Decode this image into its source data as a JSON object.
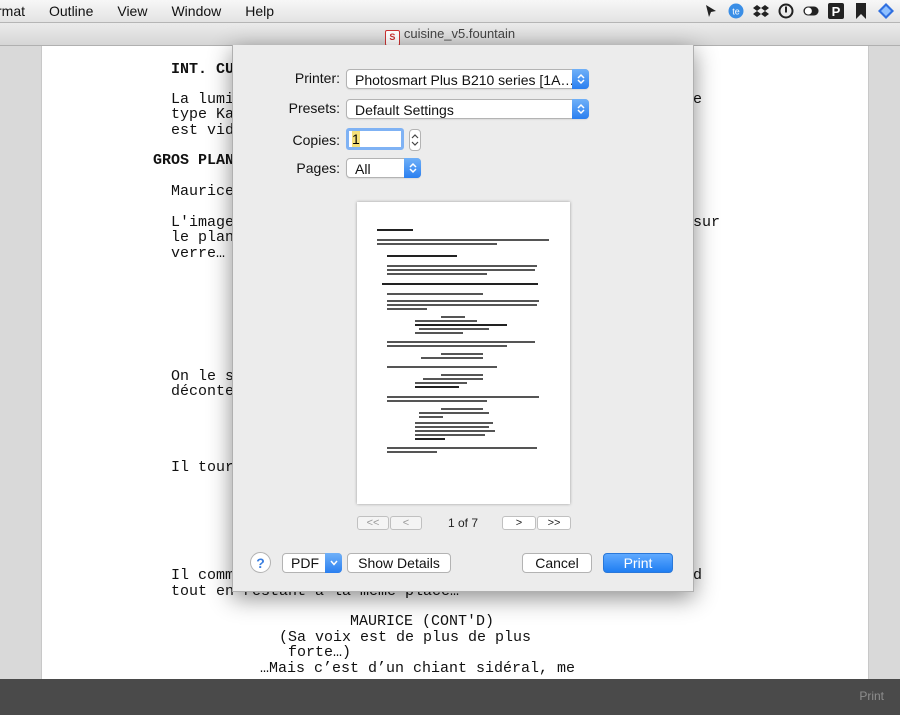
{
  "menubar": {
    "items": [
      "rmat",
      "Outline",
      "View",
      "Window",
      "Help"
    ]
  },
  "tray": {
    "icons": [
      "cursor-icon",
      "te-icon",
      "dropbox-icon",
      "power-icon",
      "toggle-icon",
      "p-icon",
      "bookmark-icon",
      "diamond-icon"
    ]
  },
  "window": {
    "title": "cuisine_v5.fountain",
    "doc_icon_glyph": "S"
  },
  "script_lines": {
    "l1": "INT. CU",
    "l2": "La lumi",
    "l3": "type Ka",
    "l4": "est vid",
    "l5": "GROS PLAN",
    "l6": "Maurice",
    "l7": "L'image",
    "l8": "le plan",
    "l9": "verre…",
    "l10": "On le s",
    "l11": "déconte",
    "l12": "Il tour",
    "l13": "Il comm",
    "l14": "tout en restant à la même place…",
    "r1": "e",
    "r2": "sur",
    "r3": "d",
    "c1": "MAURICE (CONT'D)",
    "c2": "(Sa voix est de plus de plus",
    "c3": "forte…)",
    "c4": "…Mais c’est d’un chiant sidéral, me"
  },
  "dialog": {
    "printer_label": "Printer:",
    "printer_value": "Photosmart Plus B210 series [1A…",
    "presets_label": "Presets:",
    "presets_value": "Default Settings",
    "copies_label": "Copies:",
    "copies_value": "1",
    "pages_label": "Pages:",
    "pages_value": "All",
    "page_indicator": "1 of 7",
    "nav_first": "<<",
    "nav_prev": "<",
    "nav_next": ">",
    "nav_last": ">>",
    "help": "?",
    "pdf": "PDF",
    "show_details": "Show Details",
    "cancel": "Cancel",
    "print": "Print"
  },
  "bottombar": {
    "print_label": "Print"
  },
  "colors": {
    "accent": "#2a7ff0",
    "bottombar": "#4a4a4a"
  }
}
